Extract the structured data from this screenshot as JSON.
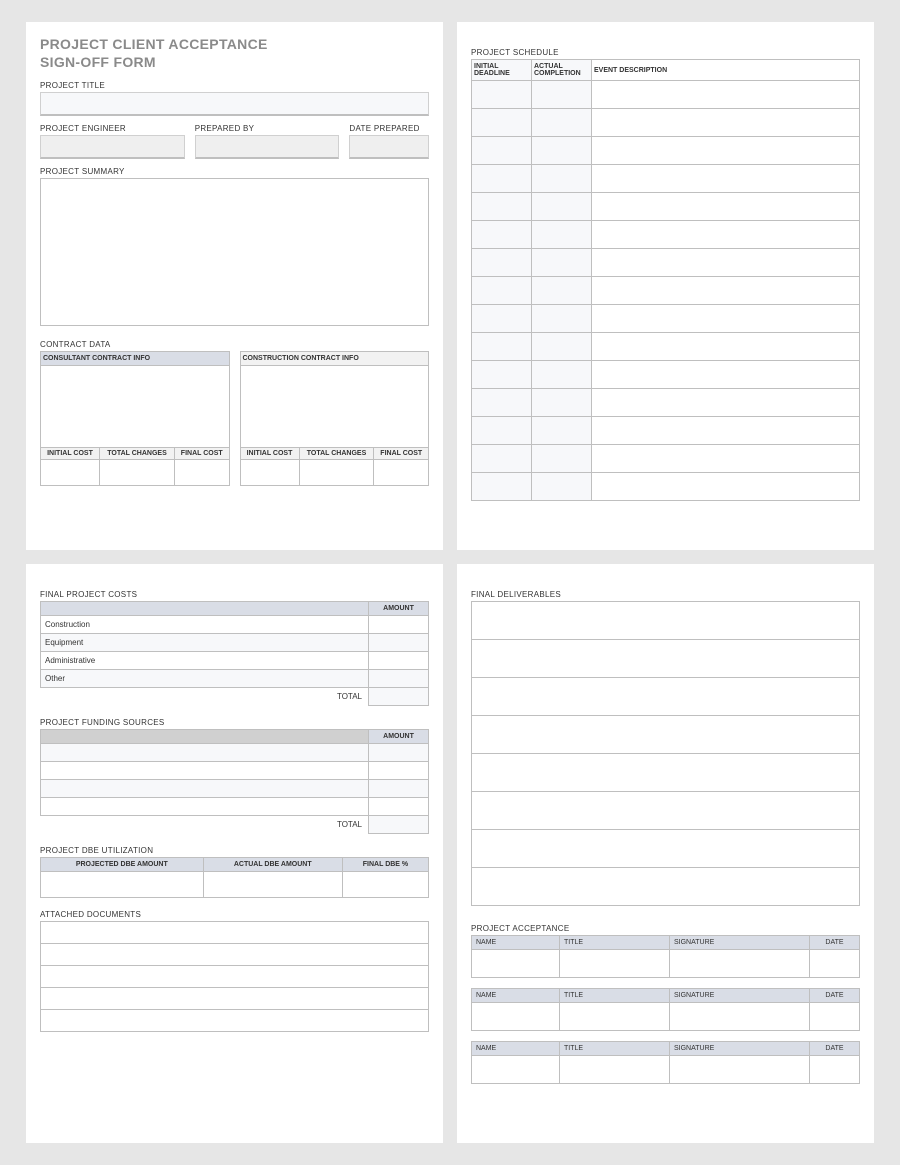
{
  "form": {
    "title_line1": "PROJECT CLIENT ACCEPTANCE",
    "title_line2": "SIGN-OFF FORM",
    "labels": {
      "project_title": "PROJECT TITLE",
      "project_engineer": "PROJECT ENGINEER",
      "prepared_by": "PREPARED BY",
      "date_prepared": "DATE PREPARED",
      "project_summary": "PROJECT SUMMARY",
      "contract_data": "CONTRACT DATA"
    },
    "contract": {
      "consultant_header": "CONSULTANT CONTRACT INFO",
      "construction_header": "CONSTRUCTION CONTRACT INFO",
      "cols": {
        "initial_cost": "INITIAL COST",
        "total_changes": "TOTAL CHANGES",
        "final_cost": "FINAL COST"
      }
    }
  },
  "schedule": {
    "title": "PROJECT SCHEDULE",
    "cols": {
      "initial_deadline": "INITIAL DEADLINE",
      "actual_completion": "ACTUAL COMPLETION",
      "event_description": "EVENT DESCRIPTION"
    },
    "row_count": 15
  },
  "costs": {
    "title": "FINAL PROJECT COSTS",
    "amount_header": "AMOUNT",
    "rows": [
      "Construction",
      "Equipment",
      "Administrative",
      "Other"
    ],
    "total_label": "TOTAL"
  },
  "funding": {
    "title": "PROJECT FUNDING SOURCES",
    "amount_header": "AMOUNT",
    "row_count": 4,
    "total_label": "TOTAL"
  },
  "dbe": {
    "title": "PROJECT DBE UTILIZATION",
    "cols": {
      "projected": "PROJECTED DBE AMOUNT",
      "actual": "ACTUAL DBE AMOUNT",
      "final_pct": "FINAL DBE %"
    }
  },
  "attached": {
    "title": "ATTACHED DOCUMENTS",
    "row_count": 5
  },
  "deliverables": {
    "title": "FINAL DELIVERABLES",
    "row_count": 8
  },
  "acceptance": {
    "title": "PROJECT ACCEPTANCE",
    "cols": {
      "name": "NAME",
      "title": "TITLE",
      "signature": "SIGNATURE",
      "date": "DATE"
    },
    "block_count": 3
  }
}
